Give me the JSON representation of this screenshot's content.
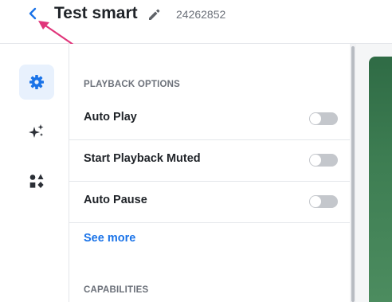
{
  "header": {
    "title": "Test smart",
    "project_id": "24262852"
  },
  "rail": {
    "items": [
      {
        "icon": "gear-icon",
        "active": true
      },
      {
        "icon": "sparkles-icon",
        "active": false
      },
      {
        "icon": "shapes-icon",
        "active": false
      }
    ]
  },
  "playback": {
    "heading": "PLAYBACK OPTIONS",
    "options": [
      {
        "label": "Auto Play",
        "enabled": false
      },
      {
        "label": "Start Playback Muted",
        "enabled": false
      },
      {
        "label": "Auto Pause",
        "enabled": false
      }
    ],
    "see_more": "See more"
  },
  "capabilities": {
    "heading": "CAPABILITIES"
  },
  "colors": {
    "accent": "#1a73e8",
    "annotation_arrow": "#e0357a",
    "preview_green": "#3d7d52"
  }
}
